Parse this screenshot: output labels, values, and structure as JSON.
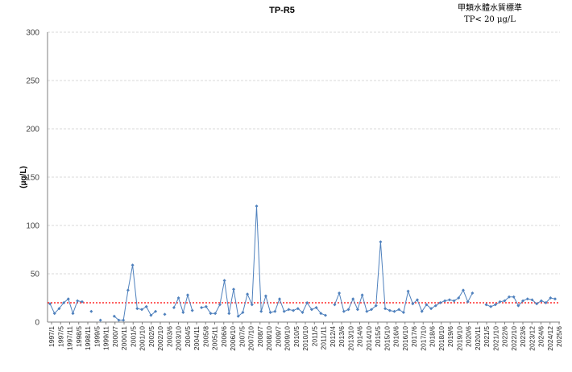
{
  "chart_data": {
    "type": "line",
    "title": "TP-R5",
    "ylabel": "(μg/L)",
    "xlabel": "",
    "ylim": [
      0,
      300
    ],
    "yticks": [
      0,
      50,
      100,
      150,
      200,
      250,
      300
    ],
    "grid": true,
    "standard_lines": [
      "甲類水體水質標準",
      "TP< 20 μg/L"
    ],
    "threshold": {
      "value": 20,
      "color": "#ff0000",
      "style": "dotted"
    },
    "colors": {
      "series": "#4f81bd",
      "axis": "#7f7f7f",
      "grid": "#d9d9d9"
    },
    "categories": [
      "1997/1",
      "1997/5",
      "1997/11",
      "1998/5",
      "1998/11",
      "1999/5",
      "1999/11",
      "2000/7",
      "2000/11",
      "2001/5",
      "2001/10",
      "2002/5",
      "2002/10",
      "2003/6",
      "2003/10",
      "2004/5",
      "2004/11",
      "2005/8",
      "2005/11",
      "2006/6",
      "2006/10",
      "2007/5",
      "2007/10",
      "2008/7",
      "2008/10",
      "2009/7",
      "2009/10",
      "2010/5",
      "2010/10",
      "2011/5",
      "2011/11",
      "2012/4",
      "2013/6",
      "2013/10",
      "2014/6",
      "2014/10",
      "2015/5",
      "2015/10",
      "2016/6",
      "2016/10",
      "2017/6",
      "2017/10",
      "2018/6",
      "2018/10",
      "2019/6",
      "2019/10",
      "2020/6",
      "2020/11",
      "2021/5",
      "2021/10",
      "2022/6",
      "2022/10",
      "2023/6",
      "2023/12",
      "2024/6",
      "2024/12",
      "2025/6"
    ],
    "series": [
      {
        "values": [
          19,
          9,
          14,
          20,
          24,
          9,
          22,
          21,
          null,
          11,
          null,
          2,
          null,
          null,
          6,
          2,
          2,
          33,
          59,
          14,
          13,
          16,
          7,
          11,
          null,
          8,
          null,
          15,
          25,
          10,
          28,
          12,
          null,
          15,
          16,
          9,
          9,
          18,
          43,
          9,
          34,
          6,
          10,
          29,
          18,
          120,
          11,
          27,
          10,
          11,
          24,
          11,
          13,
          12,
          14,
          10,
          20,
          13,
          15,
          9,
          7,
          null,
          18,
          30,
          11,
          13,
          24,
          13,
          28,
          11,
          13,
          17,
          83,
          14,
          12,
          11,
          13,
          10,
          32,
          19,
          23,
          11,
          18,
          14,
          17,
          20,
          22,
          23,
          22,
          25,
          33,
          21,
          30,
          null,
          null,
          18,
          16,
          18,
          21,
          22,
          26,
          26,
          17,
          22,
          24,
          23,
          19,
          22,
          20,
          25,
          24
        ]
      }
    ]
  }
}
